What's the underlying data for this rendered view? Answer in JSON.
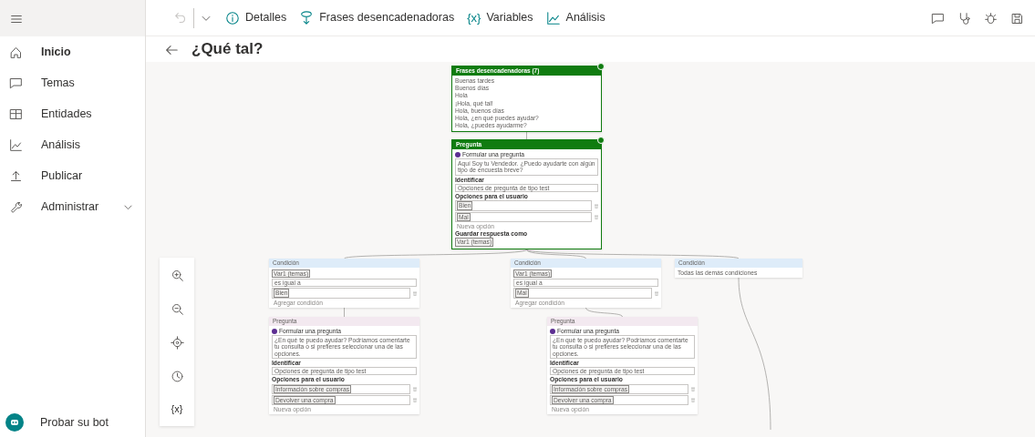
{
  "sidebar": {
    "items": [
      {
        "label": "Inicio",
        "selected": true
      },
      {
        "label": "Temas",
        "selected": false
      },
      {
        "label": "Entidades",
        "selected": false
      },
      {
        "label": "Análisis",
        "selected": false
      },
      {
        "label": "Publicar",
        "selected": false
      },
      {
        "label": "Administrar",
        "selected": false,
        "expanded": false
      }
    ],
    "footer": {
      "label": "Probar su bot"
    }
  },
  "toolbar": {
    "undo_disabled": true,
    "items": [
      {
        "label": "Detalles"
      },
      {
        "label": "Frases desencadenadoras"
      },
      {
        "glyph": "{x}",
        "label": "Variables"
      },
      {
        "label": "Análisis"
      }
    ]
  },
  "page": {
    "title": "¿Qué tal?"
  },
  "zoom_controls": {
    "variables_glyph": "{x}"
  },
  "nodes": [
    {
      "kind": "trigger",
      "selected": true,
      "title": "Frases desencadenadoras (7)",
      "rows": [
        {
          "kind": "text",
          "text": "Buenas tardes"
        },
        {
          "kind": "text",
          "text": "Buenos días"
        },
        {
          "kind": "text",
          "text": "Hola"
        },
        {
          "kind": "text",
          "text": "¡Hola, qué tal!"
        },
        {
          "kind": "text",
          "text": "Hola, buenos días"
        },
        {
          "kind": "text",
          "text": "Hola, ¿en qué puedes ayudar?"
        },
        {
          "kind": "text",
          "text": "Hola, ¿puedes ayudarme?"
        }
      ]
    },
    {
      "kind": "question",
      "selected": true,
      "title": "Pregunta",
      "rows": [
        {
          "kind": "radio",
          "text": "Formular una pregunta"
        },
        {
          "kind": "message",
          "text": "Aquí Soy tu Vendedor. ¿Puedo ayudarte con algún tipo de encuesta breve?"
        },
        {
          "kind": "label",
          "text": "Identificar"
        },
        {
          "kind": "select",
          "text": "Opciones de pregunta de tipo test"
        },
        {
          "kind": "label",
          "text": "Opciones para el usuario"
        },
        {
          "kind": "option",
          "text": "Bien"
        },
        {
          "kind": "option",
          "text": "Mal"
        },
        {
          "kind": "add",
          "text": "Nueva opción"
        },
        {
          "kind": "label",
          "text": "Guardar respuesta como"
        },
        {
          "kind": "chip",
          "text": "Var1 (temas)"
        }
      ]
    },
    {
      "kind": "condition",
      "selected": false,
      "title": "Condición",
      "rows": [
        {
          "kind": "chip",
          "text": "Var1 (temas)"
        },
        {
          "kind": "select",
          "text": "es igual a"
        },
        {
          "kind": "option",
          "text": "Bien"
        },
        {
          "kind": "add",
          "text": "Agregar condición"
        }
      ]
    },
    {
      "kind": "condition",
      "selected": false,
      "title": "Condición",
      "rows": [
        {
          "kind": "chip",
          "text": "Var1 (temas)"
        },
        {
          "kind": "select",
          "text": "es igual a"
        },
        {
          "kind": "option",
          "text": "Mal"
        },
        {
          "kind": "add",
          "text": "Agregar condición"
        }
      ]
    },
    {
      "kind": "condition",
      "selected": false,
      "title": "Condición",
      "rows": [
        {
          "kind": "text",
          "text": "Todas las demás condiciones"
        }
      ]
    },
    {
      "kind": "question",
      "selected": false,
      "title": "Pregunta",
      "rows": [
        {
          "kind": "radio",
          "text": "Formular una pregunta"
        },
        {
          "kind": "message",
          "text": "¿En qué te puedo ayudar? Podríamos comentarte tu consulta o si prefieres seleccionar una de las opciones."
        },
        {
          "kind": "label",
          "text": "Identificar"
        },
        {
          "kind": "select",
          "text": "Opciones de pregunta de tipo test"
        },
        {
          "kind": "label",
          "text": "Opciones para el usuario"
        },
        {
          "kind": "option",
          "text": "Información sobre compras"
        },
        {
          "kind": "option",
          "text": "Devolver una compra"
        },
        {
          "kind": "add",
          "text": "Nueva opción"
        }
      ]
    },
    {
      "kind": "question",
      "selected": false,
      "title": "Pregunta",
      "rows": [
        {
          "kind": "radio",
          "text": "Formular una pregunta"
        },
        {
          "kind": "message",
          "text": "¿En qué te puedo ayudar? Podríamos comentarte tu consulta o si prefieres seleccionar una de las opciones."
        },
        {
          "kind": "label",
          "text": "Identificar"
        },
        {
          "kind": "select",
          "text": "Opciones de pregunta de tipo test"
        },
        {
          "kind": "label",
          "text": "Opciones para el usuario"
        },
        {
          "kind": "option",
          "text": "Información sobre compras"
        },
        {
          "kind": "option",
          "text": "Devolver una compra"
        },
        {
          "kind": "add",
          "text": "Nueva opción"
        }
      ]
    }
  ]
}
